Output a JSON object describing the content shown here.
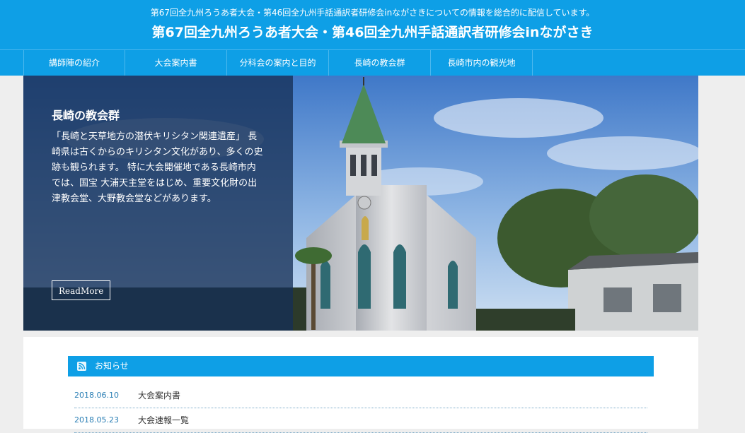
{
  "header": {
    "description": "第67回全九州ろうあ者大会・第46回全九州手話通訳者研修会inながさきについての情報を総合的に配信しています。",
    "title": "第67回全九州ろうあ者大会・第46回全九州手話通訳者研修会inながさき"
  },
  "nav": {
    "items": [
      "講師陣の紹介",
      "大会案内書",
      "分科会の案内と目的",
      "長崎の教会群",
      "長崎市内の観光地"
    ]
  },
  "hero": {
    "heading": "長崎の教会群",
    "text": "「長崎と天草地方の潜伏キリシタン関連遺産」 長崎県は古くからのキリシタン文化があり、多くの史跡も観られます。 特に大会開催地である長崎市内では、国宝 大浦天主堂をはじめ、重要文化財の出津教会堂、大野教会堂などがあります。",
    "readmore": "ReadMore"
  },
  "news": {
    "heading": "お知らせ",
    "icon": "rss-icon",
    "items": [
      {
        "date": "2018.06.10",
        "title": "大会案内書"
      },
      {
        "date": "2018.05.23",
        "title": "大会速報一覧"
      }
    ]
  },
  "colors": {
    "brand": "#0e9fe6",
    "overlay": "#163056",
    "date_text": "#2b7fb5"
  }
}
